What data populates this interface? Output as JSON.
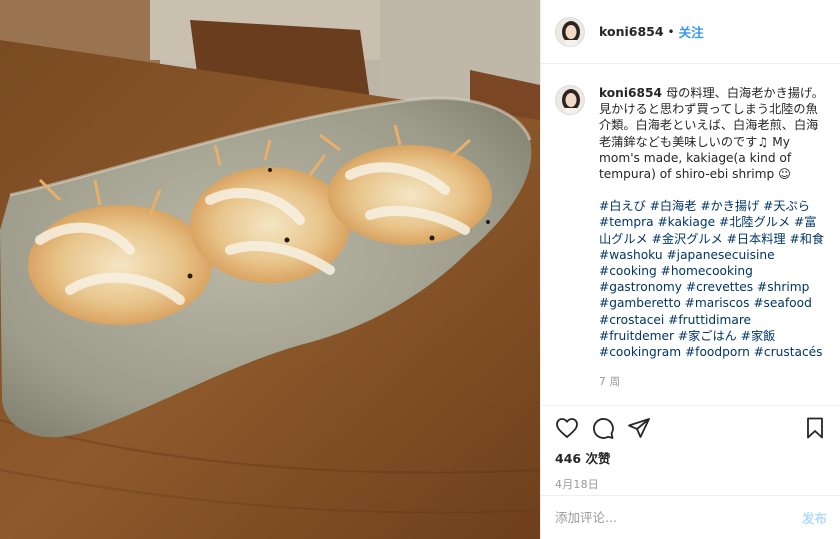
{
  "photo": {
    "alt": ""
  },
  "header": {
    "username": "koni6854",
    "separator": "•",
    "follow_label": "关注"
  },
  "caption": {
    "username": "koni6854",
    "text": "母の料理、白海老かき揚げ。見かけると思わず買ってしまう北陸の魚介類。白海老といえば、白海老煎、白海老蒲鉾なども美味しいのです♫ My mom's made, kakiage(a kind of tempura) of shiro-ebi shrimp ☺",
    "hashtags": [
      "#白えび",
      "#白海老",
      "#かき揚げ",
      "#天ぷら",
      "#tempra",
      "#kakiage",
      "#北陸グルメ",
      "#富山グルメ",
      "#金沢グルメ",
      "#日本料理",
      "#和食",
      "#washoku",
      "#japanesecuisine",
      "#cooking",
      "#homecooking",
      "#gastronomy",
      "#crevettes",
      "#shrimp",
      "#gamberetto",
      "#mariscos",
      "#seafood",
      "#crostacei",
      "#fruttidimare",
      "#fruitdemer",
      "#家ごはん",
      "#家飯",
      "#cookingram",
      "#foodporn",
      "#crustacés"
    ],
    "time_ago": "7 周"
  },
  "actions": {
    "likes": "446 次赞",
    "date": "4月18日"
  },
  "comment": {
    "placeholder": "添加评论...",
    "post_label": "发布"
  },
  "colors": {
    "accent": "#3897f0",
    "hashtag": "#003569",
    "muted": "#999999",
    "post_disabled": "#b3dbff"
  }
}
